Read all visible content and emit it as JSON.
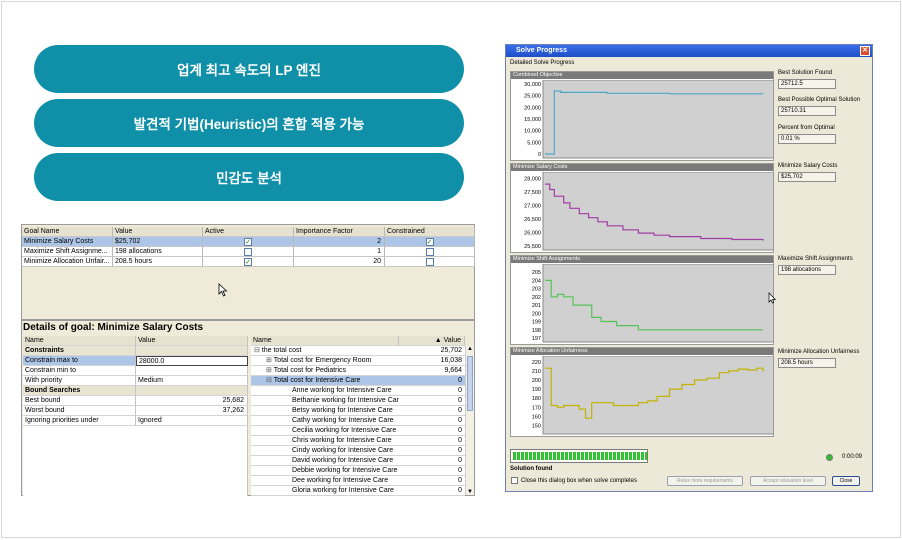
{
  "features": [
    "업계 최고 속도의 LP 엔진",
    "발견적 기법(Heuristic)의 혼합 적용 가능",
    "민감도 분석"
  ],
  "goals_table": {
    "headers": [
      "Goal Name",
      "Value",
      "Active",
      "Importance Factor",
      "Constrained"
    ],
    "rows": [
      {
        "name": "Minimize Salary Costs",
        "value": "$25,702",
        "active": true,
        "importance": "2",
        "constrained": true
      },
      {
        "name": "Maximize Shift Assignme...",
        "value": "198 allocations",
        "active": false,
        "importance": "1",
        "constrained": false
      },
      {
        "name": "Minimize Allocation Unfair...",
        "value": "208.5 hours",
        "active": true,
        "importance": "20",
        "constrained": false
      }
    ]
  },
  "details": {
    "title": "Details of goal: Minimize Salary Costs",
    "left_headers": [
      "Name",
      "Value"
    ],
    "left_rows": [
      {
        "name": "Constraints",
        "value": "",
        "section": true
      },
      {
        "name": "Constrain max to",
        "value": "28000.0",
        "selected": true
      },
      {
        "name": "Constrain min to",
        "value": ""
      },
      {
        "name": "With priority",
        "value": "Medium"
      },
      {
        "name": "Bound Searches",
        "value": "",
        "section": true
      },
      {
        "name": "Best bound",
        "value": "25,682"
      },
      {
        "name": "Worst bound",
        "value": "37,262"
      },
      {
        "name": "Ignoring priorities under",
        "value": "Ignored"
      }
    ],
    "right_headers": [
      "Name",
      "Value"
    ],
    "right_rows": [
      {
        "name": "the total cost",
        "value": "25,702",
        "level": 0,
        "toggle": "⊟"
      },
      {
        "name": "Total cost for Emergency Room",
        "value": "16,038",
        "level": 1,
        "toggle": "⊞"
      },
      {
        "name": "Total cost for Pediatrics",
        "value": "9,664",
        "level": 1,
        "toggle": "⊞"
      },
      {
        "name": "Total cost for Intensive Care",
        "value": "0",
        "level": 1,
        "toggle": "⊟",
        "selected": true
      },
      {
        "name": "Anne working for Intensive Care",
        "value": "0",
        "level": 2
      },
      {
        "name": "Bethanie working for Intensive Care",
        "value": "0",
        "level": 2
      },
      {
        "name": "Betsy working for Intensive Care",
        "value": "0",
        "level": 2
      },
      {
        "name": "Cathy working for Intensive Care",
        "value": "0",
        "level": 2
      },
      {
        "name": "Cecilia working for Intensive Care",
        "value": "0",
        "level": 2
      },
      {
        "name": "Chris working for Intensive Care",
        "value": "0",
        "level": 2
      },
      {
        "name": "Cindy working for Intensive Care",
        "value": "0",
        "level": 2
      },
      {
        "name": "David working for Intensive Care",
        "value": "0",
        "level": 2
      },
      {
        "name": "Debbie working for Intensive Care",
        "value": "0",
        "level": 2
      },
      {
        "name": "Dee working for Intensive Care",
        "value": "0",
        "level": 2
      },
      {
        "name": "Gloria working for Intensive Care",
        "value": "0",
        "level": 2
      }
    ]
  },
  "solve": {
    "title": "Solve Progress",
    "group_label": "Detailed Solve Progress",
    "charts": [
      {
        "title": "Combined Objective",
        "color": "#4ea7c7",
        "ticks": [
          "30,000",
          "25,000",
          "20,000",
          "15,000",
          "10,000",
          "5,000",
          "0"
        ],
        "ymin": 0,
        "ymax": 30000,
        "x": [
          0,
          2,
          6,
          10,
          40,
          80,
          140
        ],
        "y": [
          0,
          0,
          27000,
          26400,
          26000,
          25800,
          25712
        ]
      },
      {
        "title": "Minimize Salary Costs",
        "color": "#a23ca6",
        "ticks": [
          "28,000",
          "27,500",
          "27,000",
          "26,500",
          "26,000",
          "25,500"
        ],
        "ymin": 25500,
        "ymax": 28100,
        "x": [
          0,
          3,
          6,
          12,
          16,
          22,
          28,
          34,
          40,
          50,
          60,
          70,
          80,
          100,
          120,
          140
        ],
        "y": [
          27800,
          27600,
          27350,
          27100,
          26900,
          26700,
          26550,
          26400,
          26250,
          26100,
          25980,
          25900,
          25850,
          25780,
          25740,
          25702
        ]
      },
      {
        "title": "Minimize Shift Assignments",
        "color": "#55c255",
        "ticks": [
          "205",
          "204",
          "203",
          "202",
          "201",
          "200",
          "199",
          "198",
          "197"
        ],
        "ymin": 197,
        "ymax": 205.5,
        "x": [
          0,
          4,
          8,
          12,
          18,
          24,
          30,
          36,
          46,
          60,
          80,
          100,
          140
        ],
        "y": [
          204,
          202,
          202.3,
          202,
          201,
          201,
          199.5,
          199,
          198.5,
          198,
          198,
          198,
          198
        ]
      },
      {
        "title": "Minimize Allocation Unfairness",
        "color": "#c2b300",
        "ticks": [
          "220",
          "210",
          "200",
          "190",
          "180",
          "170",
          "160",
          "150"
        ],
        "ymin": 145,
        "ymax": 222,
        "x": [
          0,
          4,
          8,
          12,
          18,
          22,
          26,
          30,
          36,
          44,
          52,
          60,
          66,
          72,
          80,
          88,
          96,
          104,
          112,
          118,
          124,
          130,
          136,
          140
        ],
        "y": [
          213,
          172,
          170,
          172,
          172,
          168,
          158,
          175,
          175,
          172,
          172,
          175,
          177,
          182,
          190,
          195,
          200,
          202,
          208,
          210,
          212,
          211,
          213,
          209
        ]
      }
    ],
    "side": [
      {
        "label": "Best Solution Found",
        "value": "25712.5"
      },
      {
        "label": "Best Possible Optimal Solution",
        "value": "25710.31"
      },
      {
        "label": "Percent from Optimal",
        "value": "0.01 %"
      },
      {
        "label": "Minimize Salary Costs",
        "value": "$25,702"
      },
      {
        "label": "Maximize Shift Assignments",
        "value": "198 allocations"
      },
      {
        "label": "Minimize Allocation Unfairness",
        "value": "208.5 hours"
      }
    ],
    "progress": 1.0,
    "status": "Solution found",
    "elapsed": "0:00:09",
    "checkbox_label": "Close this dialog box when solve completes",
    "buttons": [
      "Relax more requirements",
      "Accept relaxation level",
      "Close"
    ],
    "status_color": "#2fbf2f"
  }
}
